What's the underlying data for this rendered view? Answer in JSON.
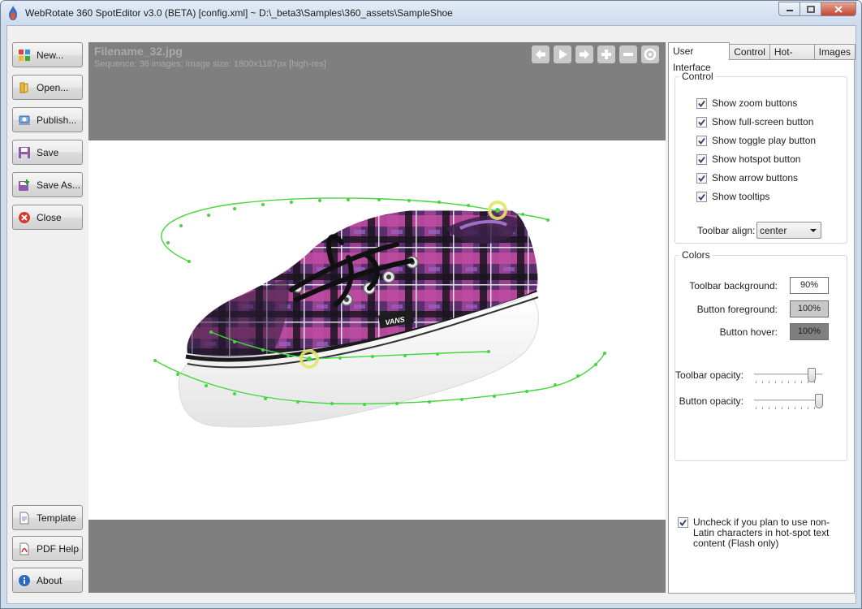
{
  "window": {
    "title": "WebRotate 360 SpotEditor v3.0 (BETA) [config.xml] ~ D:\\_beta3\\Samples\\360_assets\\SampleShoe"
  },
  "left_buttons": {
    "new": "New...",
    "open": "Open...",
    "publish": "Publish...",
    "save": "Save",
    "save_as": "Save As...",
    "close": "Close",
    "template": "Template",
    "pdf_help": "PDF Help",
    "about": "About"
  },
  "viewer": {
    "filename": "Filename_32.jpg",
    "info": "Sequence: 36 images; Image size: 1800x1187px [high-res]",
    "toolbar_icons": [
      "arrow-left-icon",
      "play-icon",
      "arrow-right-icon",
      "plus-icon",
      "minus-icon",
      "hotspot-target-icon"
    ]
  },
  "tabs": [
    "User Interface",
    "Control",
    "Hot-spots",
    "Images"
  ],
  "control": {
    "title": "Control",
    "checkboxes": [
      {
        "label": "Show zoom buttons",
        "checked": true
      },
      {
        "label": "Show full-screen button",
        "checked": true
      },
      {
        "label": "Show toggle play button",
        "checked": true
      },
      {
        "label": "Show hotspot button",
        "checked": true
      },
      {
        "label": "Show arrow buttons",
        "checked": true
      },
      {
        "label": "Show tooltips",
        "checked": true
      }
    ],
    "toolbar_align_label": "Toolbar align:",
    "toolbar_align_value": "center"
  },
  "colors": {
    "title": "Colors",
    "toolbar_background_label": "Toolbar background:",
    "toolbar_background_value": "90%",
    "toolbar_background_color": "#ffffff",
    "button_foreground_label": "Button foreground:",
    "button_foreground_value": "100%",
    "button_foreground_color": "#c8c8c8",
    "button_hover_label": "Button hover:",
    "button_hover_value": "100%",
    "button_hover_color": "#7f7f7f",
    "toolbar_opacity_label": "Toolbar opacity:",
    "toolbar_opacity": 0.85,
    "button_opacity_label": "Button opacity:",
    "button_opacity": 0.95
  },
  "non_latin_note": {
    "checked": true,
    "text": "Uncheck if you plan to use non-Latin characters in hot-spot text content (Flash only)"
  }
}
